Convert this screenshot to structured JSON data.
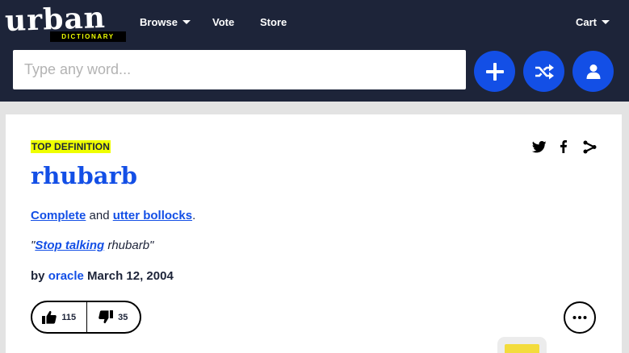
{
  "header": {
    "logo": {
      "wordmark": "urban",
      "subtitle": "DICTIONARY"
    },
    "nav": {
      "browse": "Browse",
      "vote": "Vote",
      "store": "Store",
      "cart": "Cart"
    },
    "search": {
      "placeholder": "Type any word..."
    },
    "buttons": {
      "add_icon": "plus-icon",
      "random_icon": "shuffle-icon",
      "account_icon": "user-icon"
    }
  },
  "definition": {
    "badge": "TOP DEFINITION",
    "word": "rhubarb",
    "meaning": {
      "link1": "Complete",
      "middle": " and ",
      "link2": "utter bollocks",
      "end": "."
    },
    "example": {
      "open": "\"",
      "link": "Stop talking",
      "rest": " rhubarb\""
    },
    "byline": {
      "prefix": "by ",
      "author": "oracle",
      "date": " March 12, 2004"
    },
    "votes": {
      "up": "115",
      "down": "35"
    },
    "share_icons": [
      "twitter-icon",
      "facebook-icon",
      "share-icon"
    ]
  },
  "colors": {
    "navy": "#1d2439",
    "accent_blue": "#134fe6",
    "highlight_yellow": "#efff00",
    "page_gray": "#e3e3e3"
  }
}
